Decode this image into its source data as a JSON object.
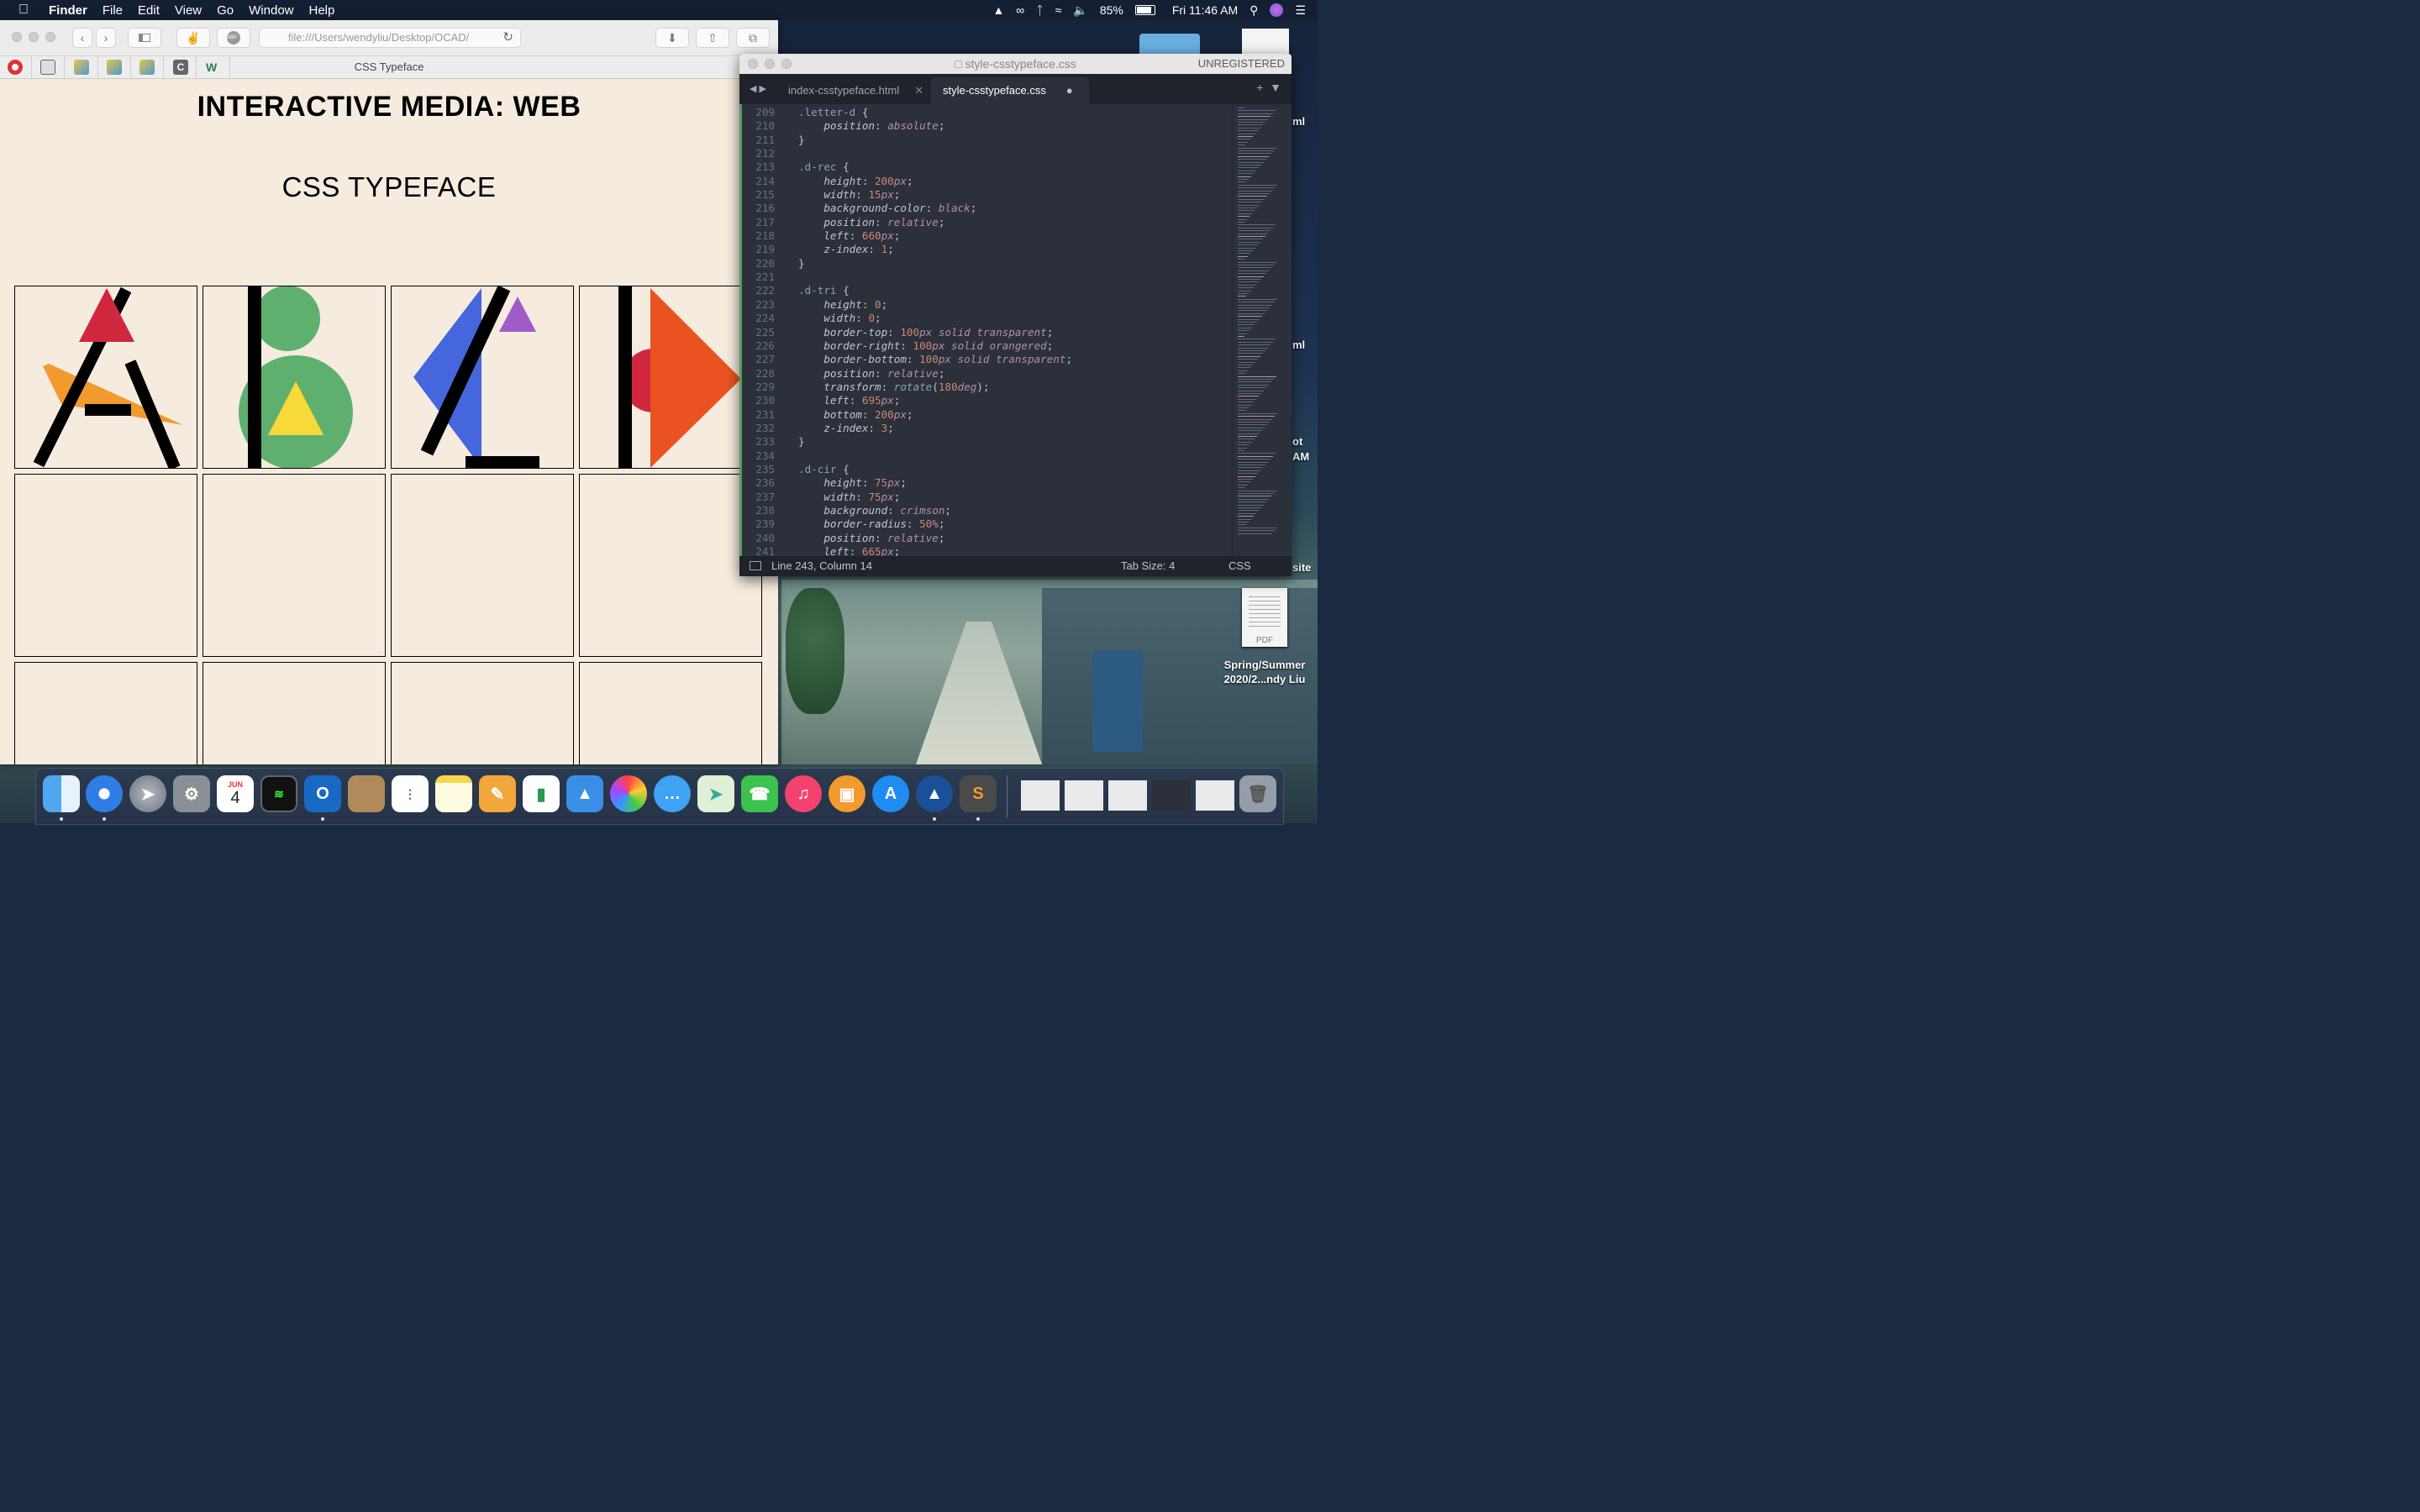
{
  "menubar": {
    "app": "Finder",
    "items": [
      "File",
      "Edit",
      "View",
      "Go",
      "Window",
      "Help"
    ],
    "battery": "85%",
    "clock": "Fri 11:46 AM"
  },
  "safari": {
    "address": "file:///Users/wendyliu/Desktop/OCAD/",
    "tab_title": "CSS Typeface",
    "page": {
      "heading": "INTERACTIVE MEDIA: WEB",
      "subheading": "CSS TYPEFACE"
    }
  },
  "sublime": {
    "title": "style-csstypeface.css",
    "unregistered": "UNREGISTERED",
    "tabs": [
      {
        "label": "index-csstypeface.html",
        "active": false
      },
      {
        "label": "style-csstypeface.css",
        "active": true
      }
    ],
    "status": {
      "position": "Line 243, Column 14",
      "tab_size": "Tab Size: 4",
      "syntax": "CSS"
    },
    "code": [
      {
        "n": "209",
        "t": "sel",
        "text": ".letter-d {"
      },
      {
        "n": "210",
        "t": "decl",
        "prop": "position",
        "val": "absolute"
      },
      {
        "n": "211",
        "t": "close",
        "text": "}"
      },
      {
        "n": "212",
        "t": "blank",
        "text": ""
      },
      {
        "n": "213",
        "t": "sel",
        "text": ".d-rec {"
      },
      {
        "n": "214",
        "t": "decl",
        "prop": "height",
        "num": "200",
        "unit": "px"
      },
      {
        "n": "215",
        "t": "decl",
        "prop": "width",
        "num": "15",
        "unit": "px"
      },
      {
        "n": "216",
        "t": "decl",
        "prop": "background-color",
        "val": "black"
      },
      {
        "n": "217",
        "t": "decl",
        "prop": "position",
        "val": "relative"
      },
      {
        "n": "218",
        "t": "decl",
        "prop": "left",
        "num": "660",
        "unit": "px"
      },
      {
        "n": "219",
        "t": "decl",
        "prop": "z-index",
        "num": "1",
        "unit": ""
      },
      {
        "n": "220",
        "t": "close",
        "text": "}"
      },
      {
        "n": "221",
        "t": "blank",
        "text": ""
      },
      {
        "n": "222",
        "t": "sel",
        "text": ".d-tri {"
      },
      {
        "n": "223",
        "t": "decl",
        "prop": "height",
        "num": "0",
        "unit": ""
      },
      {
        "n": "224",
        "t": "decl",
        "prop": "width",
        "num": "0",
        "unit": ""
      },
      {
        "n": "225",
        "t": "decl",
        "prop": "border-top",
        "num": "100",
        "unit": "px",
        "rest": " solid transparent"
      },
      {
        "n": "226",
        "t": "decl",
        "prop": "border-right",
        "num": "100",
        "unit": "px",
        "rest": " solid orangered"
      },
      {
        "n": "227",
        "t": "decl",
        "prop": "border-bottom",
        "num": "100",
        "unit": "px",
        "rest": " solid transparent"
      },
      {
        "n": "228",
        "t": "decl",
        "prop": "position",
        "val": "relative"
      },
      {
        "n": "229",
        "t": "fn",
        "prop": "transform",
        "fn": "rotate",
        "num": "180",
        "unit": "deg"
      },
      {
        "n": "230",
        "t": "decl",
        "prop": "left",
        "num": "695",
        "unit": "px"
      },
      {
        "n": "231",
        "t": "decl",
        "prop": "bottom",
        "num": "200",
        "unit": "px"
      },
      {
        "n": "232",
        "t": "decl",
        "prop": "z-index",
        "num": "3",
        "unit": ""
      },
      {
        "n": "233",
        "t": "close",
        "text": "}"
      },
      {
        "n": "234",
        "t": "blank",
        "text": ""
      },
      {
        "n": "235",
        "t": "sel",
        "text": ".d-cir {"
      },
      {
        "n": "236",
        "t": "decl",
        "prop": "height",
        "num": "75",
        "unit": "px"
      },
      {
        "n": "237",
        "t": "decl",
        "prop": "width",
        "num": "75",
        "unit": "px"
      },
      {
        "n": "238",
        "t": "decl",
        "prop": "background",
        "val": "crimson"
      },
      {
        "n": "239",
        "t": "decl",
        "prop": "border-radius",
        "num": "50",
        "unit": "%"
      },
      {
        "n": "240",
        "t": "decl",
        "prop": "position",
        "val": "relative"
      },
      {
        "n": "241",
        "t": "decl",
        "prop": "left",
        "num": "665",
        "unit": "px"
      }
    ]
  },
  "desktop": {
    "edge_labels": [
      "ml",
      "ml",
      "ot",
      "AM",
      "site"
    ],
    "pdf_label": "PDF",
    "file_label_1": "Spring/Summer",
    "file_label_2": "2020/2...ndy Liu"
  },
  "dock": {
    "calendar_month": "JUN",
    "calendar_day": "4"
  },
  "colors": {
    "page_bg": "#f5ebdf",
    "crimson": "#d0273f",
    "orange": "#f29a2e",
    "green": "#5fb06f",
    "yellow": "#f7d93a",
    "blue": "#4566dd",
    "purple": "#a05bc8",
    "orangered": "#ea5321"
  }
}
